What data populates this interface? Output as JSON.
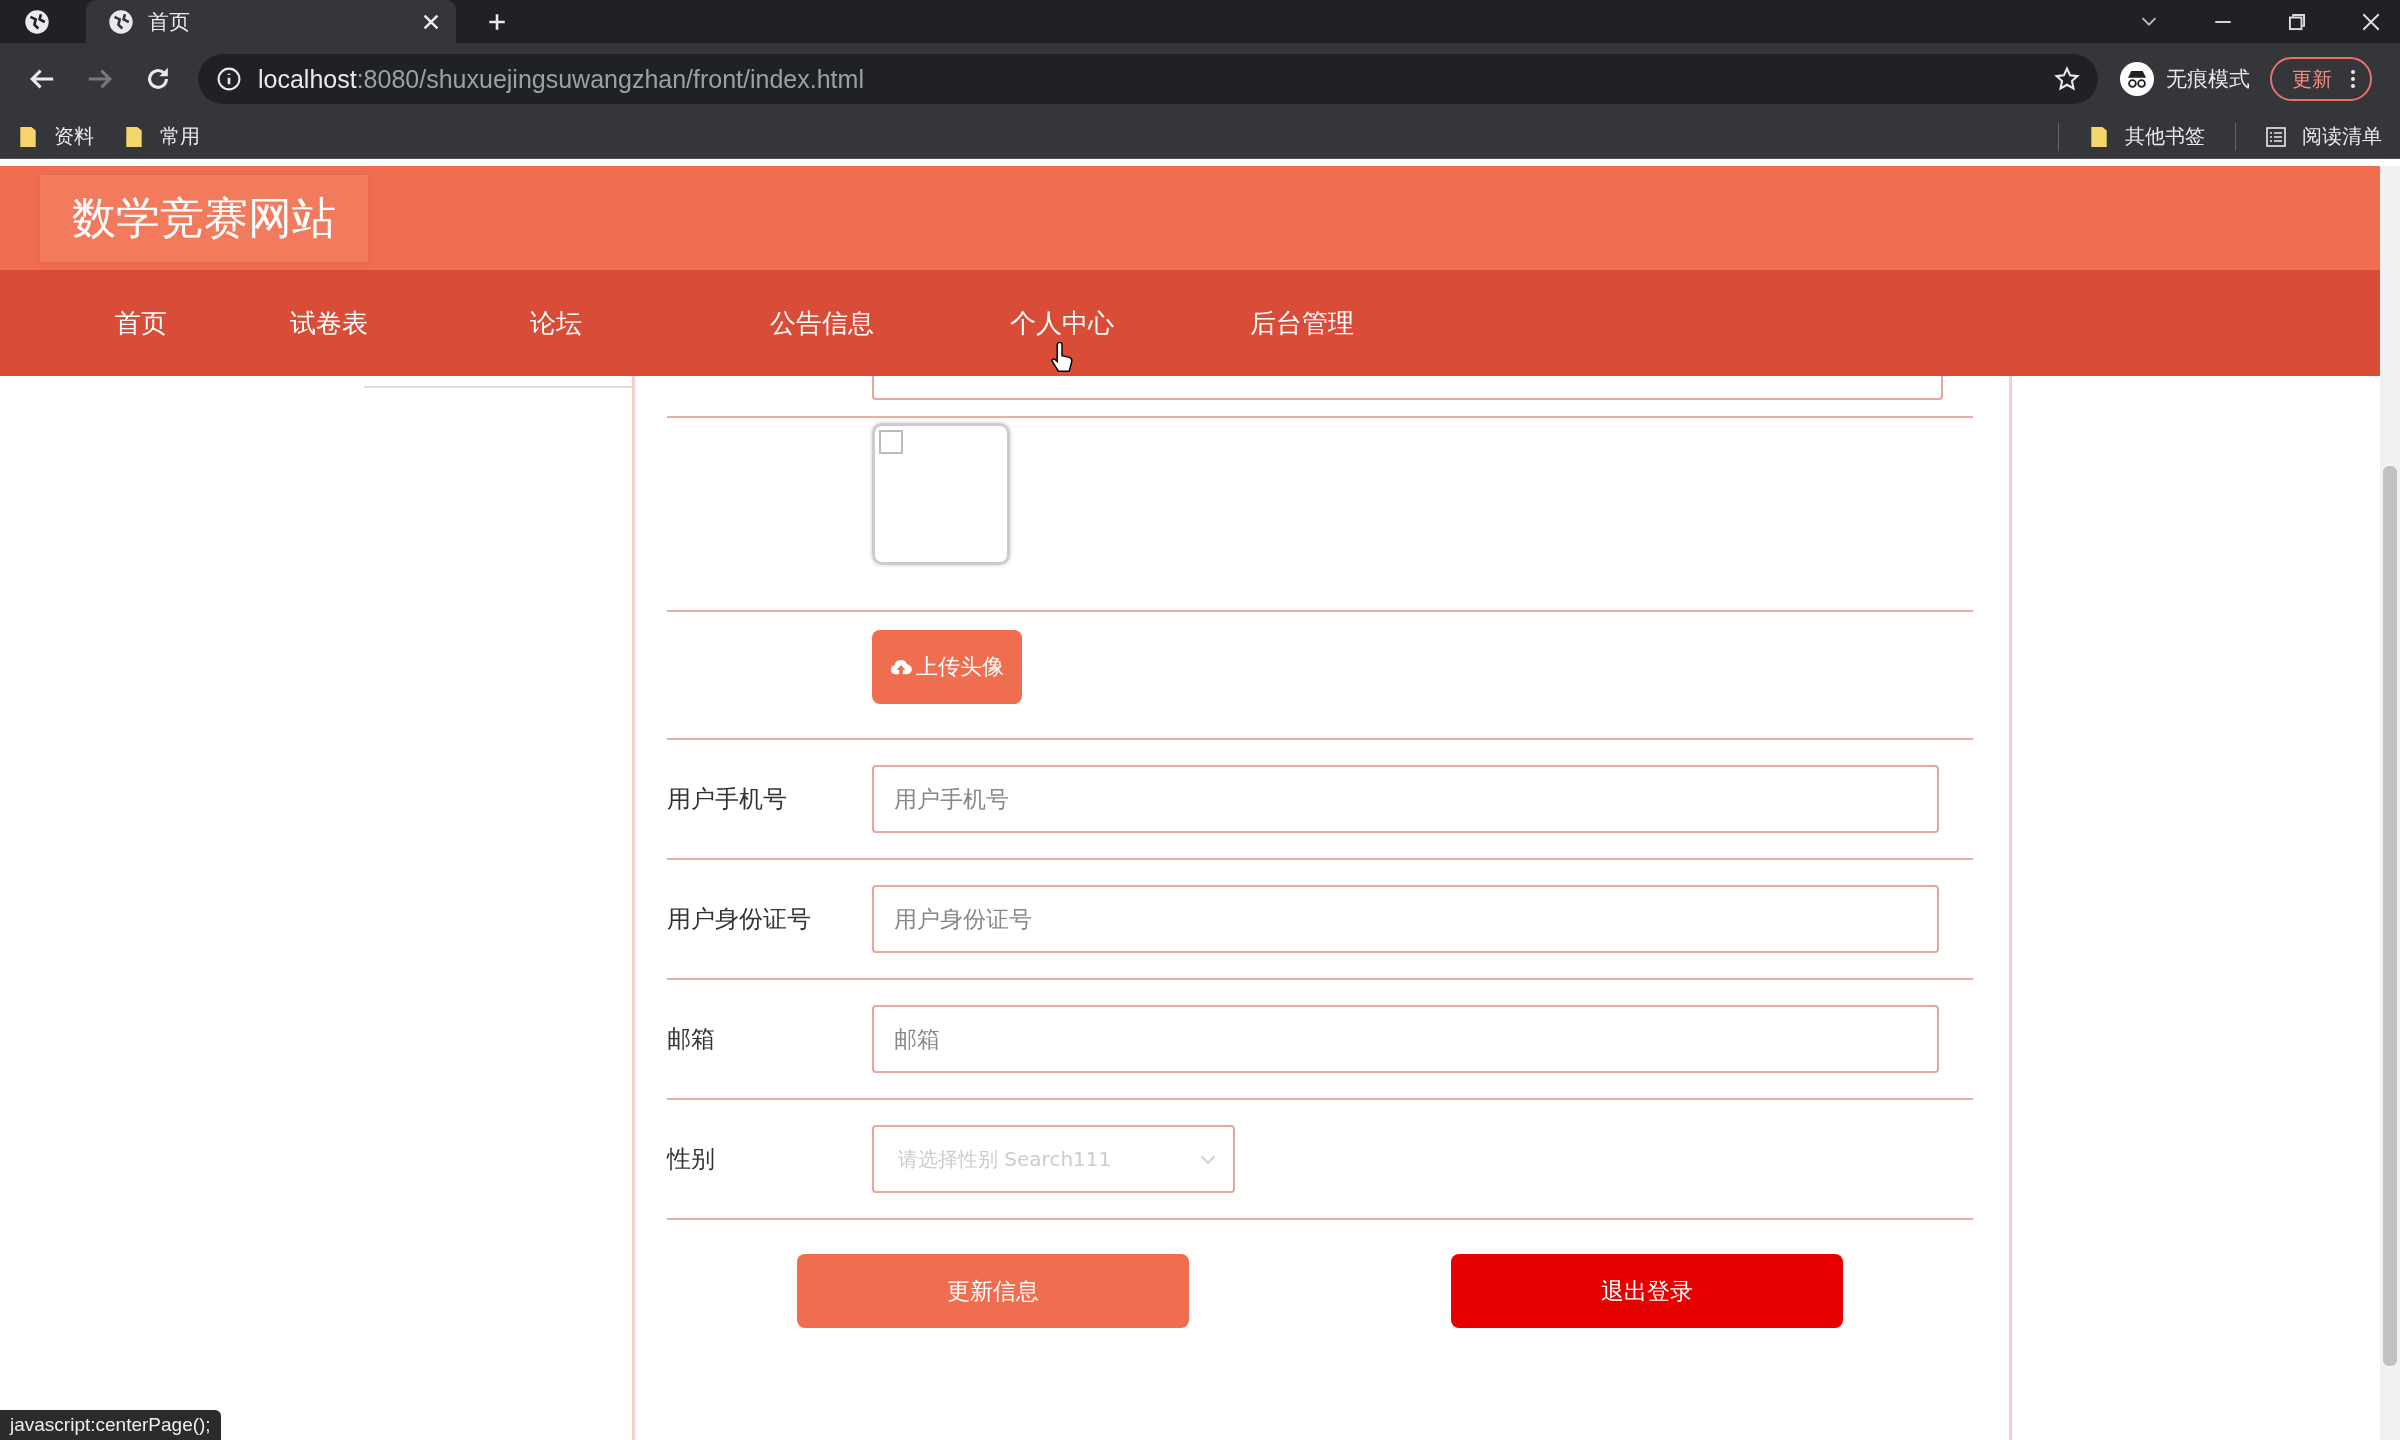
{
  "browser": {
    "tab_title": "首页",
    "url_host": "localhost",
    "url_rest": ":8080/shuxuejingsuwangzhan/front/index.html",
    "profile_label": "无痕模式",
    "update_button": "更新",
    "bookmarks": [
      "资料",
      "常用"
    ],
    "right_bookmarks": [
      {
        "label": "其他书签",
        "kind": "folder"
      },
      {
        "label": "阅读清单",
        "kind": "list"
      }
    ]
  },
  "site": {
    "title": "数学竞赛网站",
    "nav": [
      {
        "label": "首页"
      },
      {
        "label": "试卷表"
      },
      {
        "label": "论坛"
      },
      {
        "label": "公告信息"
      },
      {
        "label": "个人中心"
      },
      {
        "label": "后台管理"
      }
    ]
  },
  "form": {
    "avatar": {
      "checked": false
    },
    "upload_button": "上传头像",
    "fields": [
      {
        "kind": "input",
        "label": "用户手机号",
        "placeholder": "用户手机号"
      },
      {
        "kind": "input",
        "label": "用户身份证号",
        "placeholder": "用户身份证号"
      },
      {
        "kind": "input",
        "label": "邮箱",
        "placeholder": "邮箱"
      },
      {
        "kind": "select",
        "label": "性别",
        "placeholder": "请选择性别 Search111"
      }
    ],
    "buttons": [
      {
        "label": "更新信息",
        "kind": "primary"
      },
      {
        "label": "退出登录",
        "kind": "danger"
      }
    ]
  },
  "status_bar": "javascript:centerPage();"
}
